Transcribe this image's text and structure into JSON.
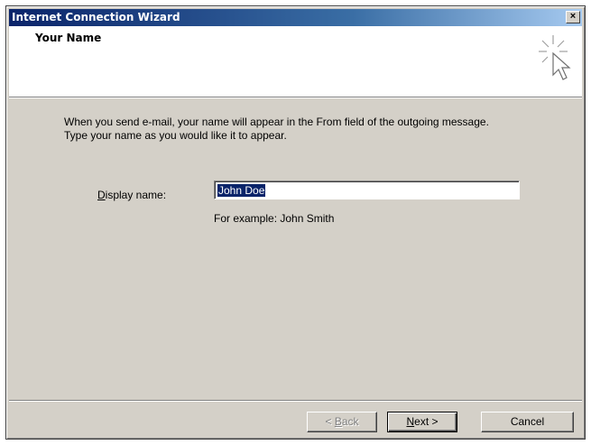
{
  "window": {
    "title": "Internet Connection Wizard",
    "close_glyph": "×"
  },
  "header": {
    "title": "Your Name",
    "icon": "wizard-cursor-icon"
  },
  "body": {
    "description_line1": "When you send e-mail, your name will appear in the From field of the outgoing message.",
    "description_line2": "Type your name as you would like it to appear."
  },
  "form": {
    "display_name_label_mnemonic": "D",
    "display_name_label_rest": "isplay name:",
    "display_name_value": "John Doe",
    "example_text": "For example: John Smith"
  },
  "buttons": {
    "back_prefix": "< ",
    "back_mnemonic": "B",
    "back_rest": "ack",
    "next_mnemonic": "N",
    "next_rest": "ext >",
    "cancel": "Cancel"
  },
  "colors": {
    "titlebar_start": "#0a246a",
    "titlebar_end": "#a6caf0",
    "dialog_face": "#d4d0c8",
    "selection": "#0a246a"
  }
}
